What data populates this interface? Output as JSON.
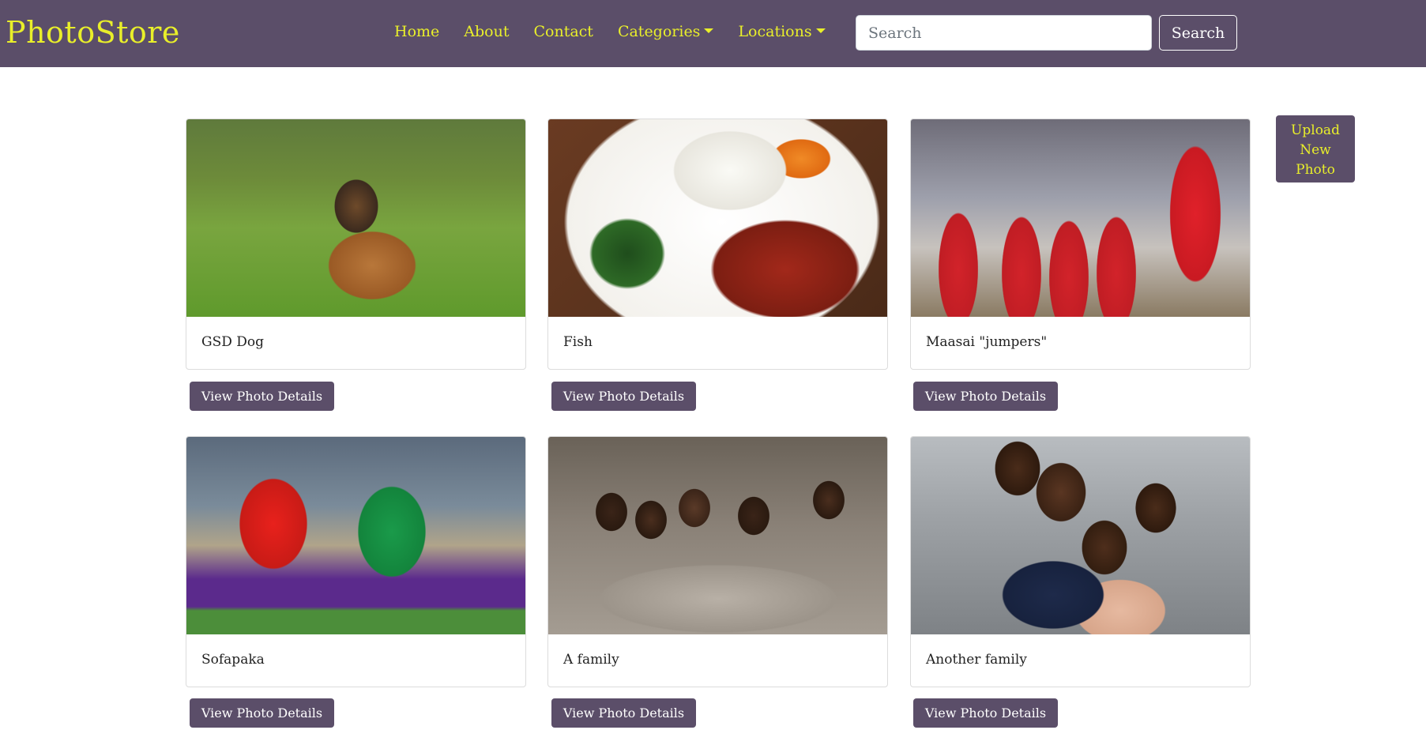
{
  "navbar": {
    "brand": "PhotoStore",
    "links": {
      "home": "Home",
      "about": "About",
      "contact": "Contact",
      "categories": "Categories",
      "locations": "Locations"
    },
    "search_placeholder": "Search",
    "search_button": "Search"
  },
  "upload_button": {
    "line1": "Upload",
    "line2": "New",
    "line3": "Photo"
  },
  "photos": [
    {
      "title": "GSD Dog",
      "button": "View Photo Details",
      "image": "german-shepherd-dog"
    },
    {
      "title": "Fish",
      "button": "View Photo Details",
      "image": "fish-ugali-sukuma-plate"
    },
    {
      "title": "Maasai \"jumpers\"",
      "button": "View Photo Details",
      "image": "maasai-warriors"
    },
    {
      "title": "Sofapaka",
      "button": "View Photo Details",
      "image": "football-players"
    },
    {
      "title": "A family",
      "button": "View Photo Details",
      "image": "family-on-sofa"
    },
    {
      "title": "Another family",
      "button": "View Photo Details",
      "image": "family-in-kitchen"
    }
  ],
  "colors": {
    "navbar_bg": "#5b4e69",
    "accent_yellow": "#e9ef2a",
    "button_bg": "#5b4e69",
    "button_text": "#ffffff"
  }
}
